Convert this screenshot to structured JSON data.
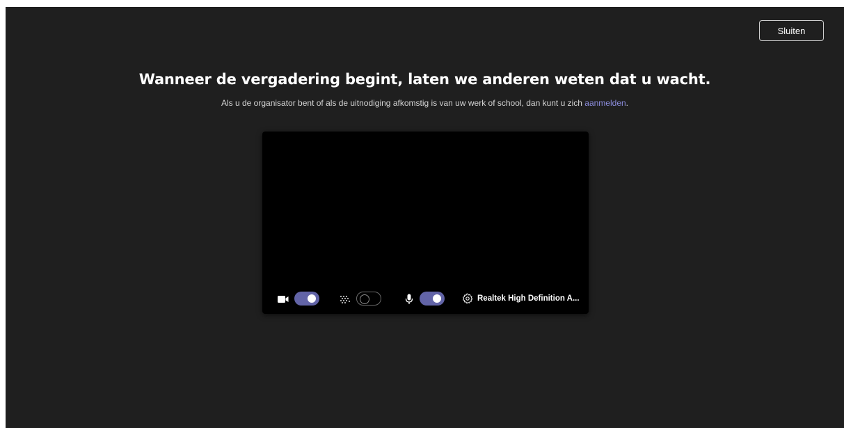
{
  "header": {
    "close_label": "Sluiten"
  },
  "main": {
    "title": "Wanneer de vergadering begint, laten we anderen weten dat u wacht.",
    "subtitle_before": "Als u de organisator bent of als de uitnodiging afkomstig is van uw werk of school, dan kunt u zich ",
    "signin_link": "aanmelden",
    "subtitle_after": "."
  },
  "preview": {
    "controls": {
      "camera_icon": "video-camera-icon",
      "camera_on": true,
      "blur_icon": "background-blur-icon",
      "blur_on": false,
      "mic_icon": "microphone-icon",
      "mic_on": true,
      "settings_icon": "gear-icon",
      "audio_device": "Realtek High Definition A..."
    }
  },
  "colors": {
    "background": "#1f1f1f",
    "accent": "#6264a7",
    "link": "#8b8cdc",
    "preview": "#000000"
  }
}
